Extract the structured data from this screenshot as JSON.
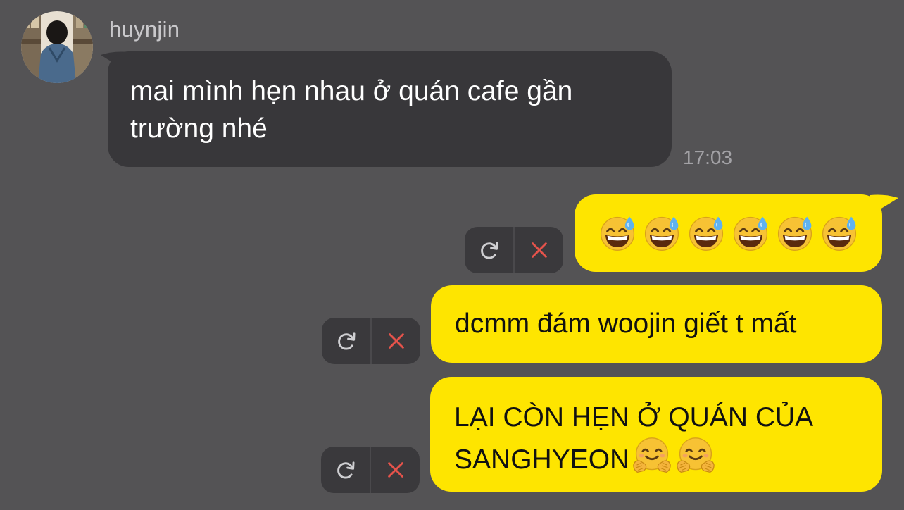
{
  "incoming": {
    "sender_name": "huynjin",
    "message": "mai mình hẹn nhau ở quán cafe gần trường nhé",
    "time": "17:03"
  },
  "outgoing": [
    {
      "text": "",
      "emoji": [
        "grinning-face-with-sweat",
        "grinning-face-with-sweat",
        "grinning-face-with-sweat",
        "grinning-face-with-sweat",
        "grinning-face-with-sweat",
        "grinning-face-with-sweat"
      ],
      "status": "failed"
    },
    {
      "text": "dcmm đám woojin giết t mất",
      "emoji": [],
      "status": "failed"
    },
    {
      "text": "LẠI CÒN HẸN Ở QUÁN CỦA SANGHYEON",
      "emoji": [
        "hugging-face",
        "hugging-face"
      ],
      "status": "failed"
    }
  ],
  "failed_controls": {
    "retry_icon": "retry-icon",
    "delete_icon": "close-icon"
  },
  "colors": {
    "background": "#545355",
    "incoming_bubble": "#38373a",
    "outgoing_bubble": "#fee500",
    "delete_icon": "#e5534b",
    "timestamp": "#a3a2a6"
  }
}
